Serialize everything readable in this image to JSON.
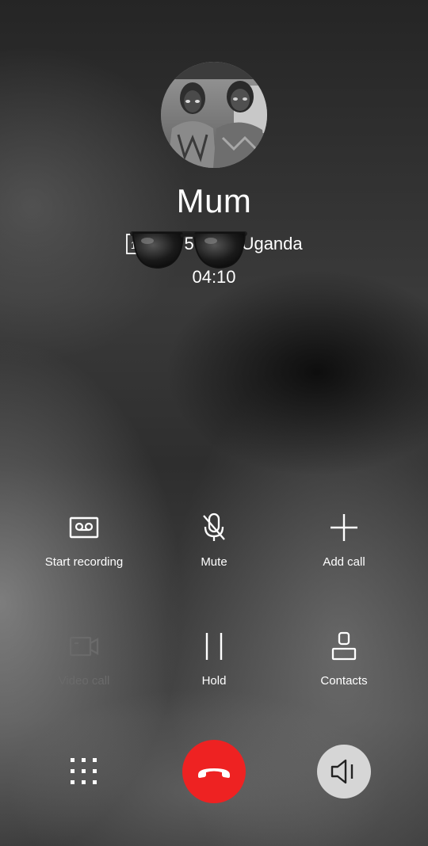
{
  "caller": {
    "name": "Mum",
    "number_partial_start": "0",
    "number_partial_mid": "5",
    "location": "Uganda",
    "sim_slot": "1",
    "duration": "04:10"
  },
  "actions": [
    {
      "label": "Start recording",
      "icon": "voicemail-icon",
      "enabled": true
    },
    {
      "label": "Mute",
      "icon": "mic-off-icon",
      "enabled": true
    },
    {
      "label": "Add call",
      "icon": "plus-icon",
      "enabled": true
    },
    {
      "label": "Video call",
      "icon": "video-camera-icon",
      "enabled": false
    },
    {
      "label": "Hold",
      "icon": "pause-icon",
      "enabled": true
    },
    {
      "label": "Contacts",
      "icon": "person-icon",
      "enabled": true
    }
  ],
  "bottom_controls": {
    "keypad_icon": "dialpad-icon",
    "end_call_icon": "phone-hangup-icon",
    "speaker_icon": "speaker-icon"
  },
  "colors": {
    "end_call": "#ee2222",
    "speaker_button": "#d6d6d6",
    "disabled_text": "#6a6a6a",
    "text": "#ffffff"
  }
}
